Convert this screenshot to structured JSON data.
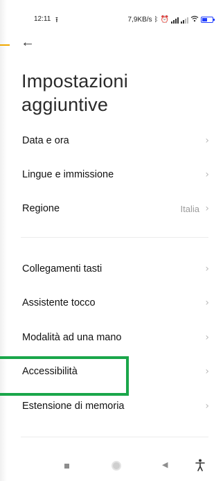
{
  "status_bar": {
    "time": "12:11",
    "speed": "7,9KB/s",
    "icons": [
      "upload-icon",
      "bluetooth-icon",
      "alarm-icon",
      "signal-icon",
      "signal-icon",
      "wifi-icon",
      "battery-icon"
    ]
  },
  "header": {
    "back_icon": "←",
    "title": "Impostazioni aggiuntive"
  },
  "settings": {
    "date_time": {
      "label": "Data e ora"
    },
    "languages": {
      "label": "Lingue e immissione"
    },
    "region": {
      "label": "Regione",
      "value": "Italia"
    },
    "shortcuts": {
      "label": "Collegamenti tasti"
    },
    "assistant": {
      "label": "Assistente tocco"
    },
    "one_hand": {
      "label": "Modalità ad una mano"
    },
    "accessibility": {
      "label": "Accessibilità"
    },
    "memory": {
      "label": "Estensione di memoria"
    }
  },
  "chevron": "›",
  "highlight_color": "#1aa64a",
  "nav_icons": [
    "recents-icon",
    "home-icon",
    "back-icon",
    "accessibility-icon"
  ]
}
